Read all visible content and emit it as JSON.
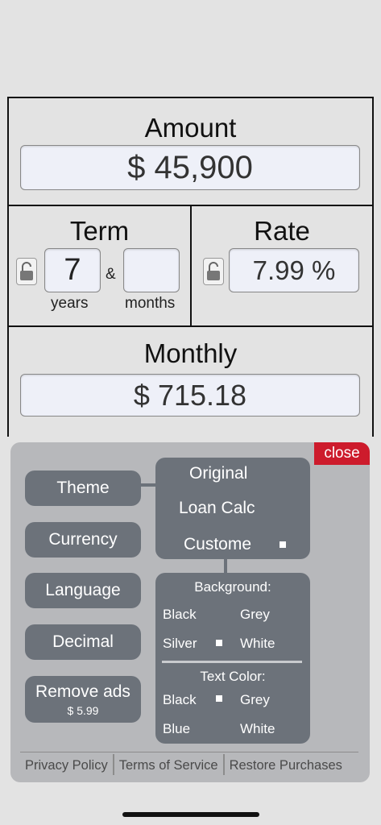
{
  "calculator": {
    "amount": {
      "title": "Amount",
      "value": "$ 45,900"
    },
    "term": {
      "title": "Term",
      "years_value": "7",
      "months_value": "",
      "separator": "&",
      "years_label": "years",
      "months_label": "months"
    },
    "rate": {
      "title": "Rate",
      "value": "7.99 %"
    },
    "monthly": {
      "title": "Monthly",
      "value": "$ 715.18"
    }
  },
  "settings": {
    "close_label": "close",
    "menu": {
      "theme": "Theme",
      "currency": "Currency",
      "language": "Language",
      "decimal": "Decimal",
      "remove_ads": "Remove ads",
      "remove_ads_price": "$ 5.99"
    },
    "theme_options": {
      "original": "Original",
      "loan_calc": "Loan Calc",
      "custome": "Custome",
      "selected": "custome"
    },
    "custom": {
      "background_heading": "Background:",
      "background_options": [
        "Black",
        "Grey",
        "Silver",
        "White"
      ],
      "background_selected": "Silver",
      "text_color_heading": "Text Color:",
      "text_color_options": [
        "Black",
        "Grey",
        "Blue",
        "White"
      ],
      "text_color_selected": "Black"
    },
    "footer": {
      "privacy": "Privacy Policy",
      "terms": "Terms of Service",
      "restore": "Restore Purchases"
    }
  },
  "colors": {
    "accent_close": "#cd1b2c",
    "button_bg": "#6c727a",
    "panel_bg": "#b7b8bb",
    "page_bg": "#e3e3e3"
  },
  "icons": {
    "lock": "unlocked-padlock-icon"
  }
}
